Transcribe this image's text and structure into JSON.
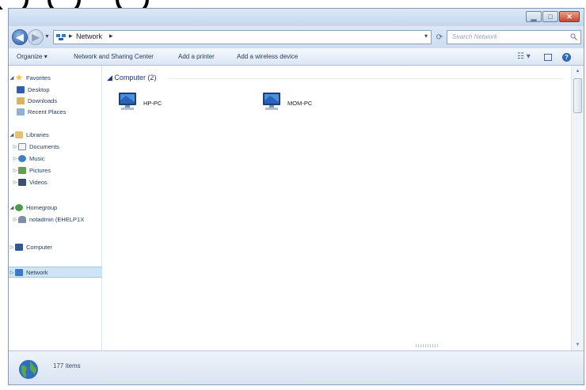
{
  "address": {
    "location": "Network",
    "search_placeholder": "Search Network"
  },
  "toolbar": {
    "organize": "Organize",
    "network_sharing_center": "Network and Sharing Center",
    "add_printer": "Add a printer",
    "add_wireless": "Add a wireless device"
  },
  "navpane": {
    "favorites": "Favorites",
    "desktop": "Desktop",
    "downloads": "Downloads",
    "recent_places": "Recent Places",
    "libraries": "Libraries",
    "documents": "Documents",
    "music": "Music",
    "pictures": "Pictures",
    "videos": "Videos",
    "homegroup": "Homegroup",
    "homegroup_user": "notadmin (EHELP1X",
    "computer": "Computer",
    "network": "Network"
  },
  "content": {
    "group_header": "Computer (2)",
    "computers": [
      {
        "name": "HP-PC"
      },
      {
        "name": "MOM-PC"
      }
    ]
  },
  "details": {
    "item_count": "177 items"
  },
  "colors": {
    "accent": "#2f67b5",
    "selection": "#cde6f7",
    "header_text": "#1e3287"
  }
}
